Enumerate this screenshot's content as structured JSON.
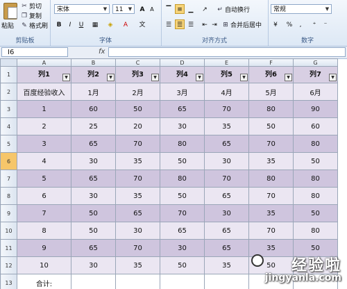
{
  "ribbon": {
    "clipboard": {
      "paste": "粘贴",
      "cut": "剪切",
      "copy": "复制",
      "format_painter": "格式刷",
      "title": "剪贴板"
    },
    "font": {
      "name": "宋体",
      "size": "11",
      "grow": "A",
      "shrink": "A",
      "bold": "B",
      "italic": "I",
      "underline": "U",
      "font_color": "A",
      "phonetic": "文",
      "title": "字体"
    },
    "alignment": {
      "wrap": "自动换行",
      "merge": "合并后居中",
      "title": "对齐方式"
    },
    "number": {
      "format": "常规",
      "percent": "%",
      "comma": ",",
      "title": "数字"
    }
  },
  "formula_bar": {
    "cell_ref": "I6",
    "fx": "fx",
    "value": ""
  },
  "columns": [
    "A",
    "B",
    "C",
    "D",
    "E",
    "F",
    "G"
  ],
  "row_numbers": [
    "1",
    "2",
    "3",
    "4",
    "5",
    "6",
    "7",
    "8",
    "9",
    "10",
    "11",
    "12",
    "13"
  ],
  "selected_row": "6",
  "header_row": [
    "列1",
    "列2",
    "列3",
    "列4",
    "列5",
    "列6",
    "列7"
  ],
  "data_rows": [
    [
      "百度经验收入",
      "1月",
      "2月",
      "3月",
      "4月",
      "5月",
      "6月"
    ],
    [
      "1",
      "60",
      "50",
      "65",
      "70",
      "80",
      "90"
    ],
    [
      "2",
      "25",
      "20",
      "30",
      "35",
      "50",
      "60"
    ],
    [
      "3",
      "65",
      "70",
      "80",
      "65",
      "70",
      "80"
    ],
    [
      "4",
      "30",
      "35",
      "50",
      "30",
      "35",
      "50"
    ],
    [
      "5",
      "65",
      "70",
      "80",
      "70",
      "80",
      "80"
    ],
    [
      "6",
      "30",
      "35",
      "50",
      "65",
      "70",
      "80"
    ],
    [
      "7",
      "50",
      "65",
      "70",
      "30",
      "35",
      "50"
    ],
    [
      "8",
      "50",
      "30",
      "65",
      "65",
      "70",
      "80"
    ],
    [
      "9",
      "65",
      "70",
      "30",
      "65",
      "35",
      "50"
    ],
    [
      "10",
      "30",
      "35",
      "50",
      "35",
      "50",
      ""
    ]
  ],
  "total_row": [
    "合计:",
    "",
    "",
    "",
    "",
    "",
    ""
  ],
  "watermark": {
    "title": "经验啦",
    "url": "jingyanla.com"
  }
}
